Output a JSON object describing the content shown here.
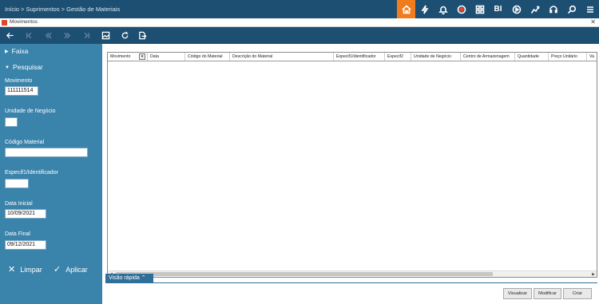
{
  "header": {
    "breadcrumb": "Início > Suprimentos > Gestão de Materiais",
    "icons": [
      "home-icon",
      "bolt-icon",
      "bell-icon",
      "record-icon",
      "grid-icon",
      "bi-icon",
      "play-icon",
      "chart-icon",
      "headset-icon",
      "search-icon",
      "menu-icon"
    ],
    "bi_label": "BI",
    "accent_color": "#f07c1e",
    "bar_color": "#1d4f73"
  },
  "window": {
    "title": "Movimentos"
  },
  "toolbar": {
    "icons": [
      "back-arrow-icon",
      "first-icon",
      "previous-icon",
      "next-icon",
      "last-icon",
      "image-icon",
      "refresh-icon",
      "export-icon"
    ]
  },
  "sidebar": {
    "sections": {
      "faixa": "Faixa",
      "pesquisar": "Pesquisar"
    },
    "fields": {
      "movimento": {
        "label": "Movimento",
        "value": "111111514"
      },
      "unidade": {
        "label": "Unidade de Negócio",
        "value": ""
      },
      "codigo": {
        "label": "Código Material",
        "value": ""
      },
      "especif": {
        "label": "Especif1/Identificador",
        "value": ""
      },
      "data_inicial": {
        "label": "Data Inicial",
        "value": "10/09/2021"
      },
      "data_final": {
        "label": "Data Final",
        "value": "09/12/2021"
      }
    },
    "buttons": {
      "limpar": "Limpar",
      "aplicar": "Aplicar"
    },
    "bg_color": "#3a83ab"
  },
  "grid": {
    "columns": [
      "Movimento",
      "Data",
      "Código do Material",
      "Descrição do Material",
      "Especif1/Identificador",
      "Especif2",
      "Unidade de Negócio",
      "Centro de Armazenagem",
      "Quantidade",
      "Preço Unitário",
      "Va"
    ],
    "rows": []
  },
  "quick_view": {
    "label": "Visão rápida"
  },
  "actions": {
    "visualizar": "Visualizar",
    "modificar": "Modificar",
    "criar": "Criar"
  }
}
